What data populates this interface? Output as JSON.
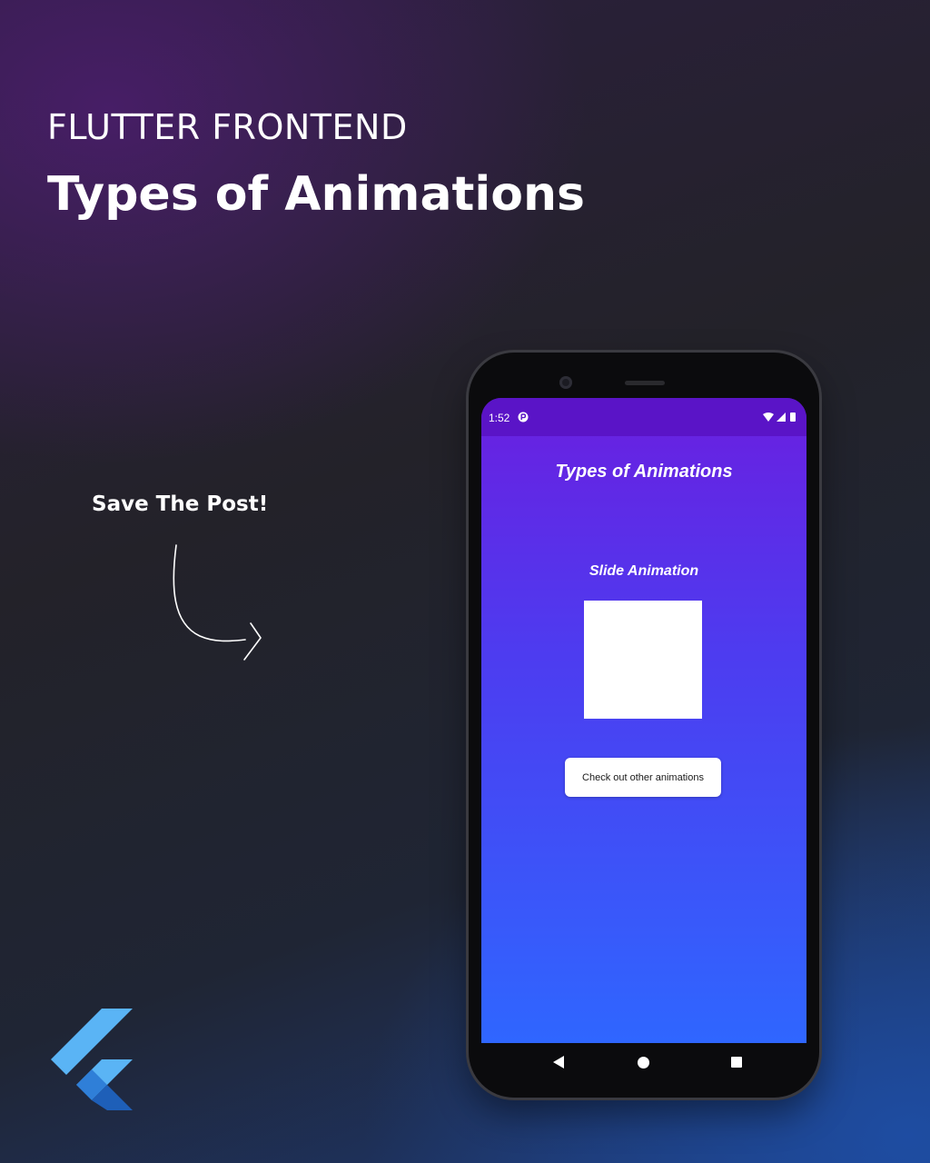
{
  "poster": {
    "eyebrow": "FLUTTER FRONTEND",
    "headline": "Types of Animations",
    "save_note": "Save The Post!",
    "logo_icon": "flutter-logo-icon",
    "arrow_icon": "curved-arrow-icon"
  },
  "device": {
    "status_bar": {
      "time": "1:52",
      "app_icon": "notification-app-icon",
      "icons": [
        "wifi-icon",
        "signal-icon",
        "battery-icon"
      ]
    },
    "app": {
      "title": "Types of Animations",
      "section_label": "Slide Animation",
      "button_label": "Check out other animations"
    },
    "nav_bar": {
      "icons": [
        "back-triangle-icon",
        "home-circle-icon",
        "recents-square-icon"
      ]
    }
  },
  "colors": {
    "app_gradient_top": "#6a1fe0",
    "app_gradient_bottom": "#2f66ff",
    "status_bar": "#5a14c7",
    "flutter_light": "#5ab4f5",
    "flutter_dark": "#1e5fb8"
  }
}
